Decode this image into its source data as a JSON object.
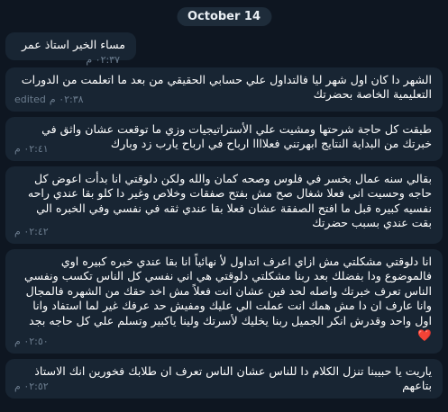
{
  "date_separator": "October 14",
  "messages": [
    {
      "text": "مساء الخير استاذ عمر",
      "time": "٠٢:٣٧ م",
      "edited": ""
    },
    {
      "text": "الشهر دا كان اول شهر ليا فالتداول علي حسابي الحقيقي من بعد ما اتعلمت من الدورات التعليمية الخاصة بحضرتك",
      "time": "٠٢:٣٨ م",
      "edited": "edited"
    },
    {
      "text": "طبقت كل حاجة شرحتها ومشيت علي الأستراتيجيات وزي ما توقعت عشان واثق في خبرتك من البداية النتايج ابهرتني فعلاااا ارباح في ارباح يارب زد وبارك",
      "time": "٠٢:٤١ م",
      "edited": ""
    },
    {
      "text": "بقالي سنه عمال بخسر في فلوس وصحه كمان والله ولكن دلوقتي انا بدأت اعوض كل حاجه وحسيت اني فعلا شغال صح مش بفتح صفقات وخلاص وغير دا كلو بقا عندي راحه نفسيه كبيره قبل ما افتح الصفقة عشان فعلا بقا عندي ثقه في نفسي وفي الخبره الي بقت عندي بسبب حضرتك",
      "time": "٠٢:٤٢ م",
      "edited": ""
    },
    {
      "text": "انا دلوقتي مشكلتي مش ازاي اعرف اتداول لأ نهائياً انا بقا عندي خبره كبيره اوي فالموضوع ودا بفضلك بعد ربنا مشكلتي دلوقتي هي اني نفسي كل الناس تكسب ونفسي الناس تعرف خبرتك واصله لحد فين عشان انت فعلاً مش اخد حقك من الشهره فالمجال وانا عارف ان دا مش همك انت عملت الي عليك ومفيش حد عرفك غير لما استفاد وانا اول واحد وقدرش انكر الجميل ربنا يخليك لأسرتك ولينا ياكبير وتسلم علي كل حاجه بجد",
      "time": "٠٢:٥٠ م",
      "edited": "",
      "emoji": "❤️"
    },
    {
      "text": "ياريت يا حبيبنا تنزل الكلام دا للناس عشان الناس تعرف ان طلابك فخورين انك الاستاذ بتاعهم",
      "time": "٠٢:٥٢ م",
      "edited": ""
    }
  ]
}
